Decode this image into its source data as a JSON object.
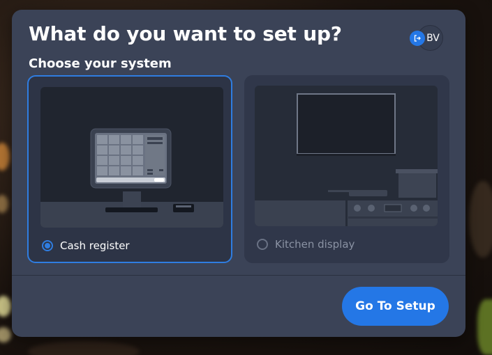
{
  "dialog": {
    "title": "What do you want to set up?",
    "subtitle": "Choose your system",
    "user": {
      "initials": "BV",
      "badge_icon": "sign-out-icon"
    },
    "options": [
      {
        "label": "Cash register",
        "selected": true,
        "illustration": "pos-terminal-icon"
      },
      {
        "label": "Kitchen display",
        "selected": false,
        "illustration": "kitchen-display-icon"
      }
    ],
    "primary_button": "Go To Setup"
  },
  "colors": {
    "dialog_bg": "#3b4357",
    "accent": "#2477e6",
    "selected_border": "#2f7de1",
    "text": "#ffffff",
    "muted_text": "#8a92a3"
  }
}
